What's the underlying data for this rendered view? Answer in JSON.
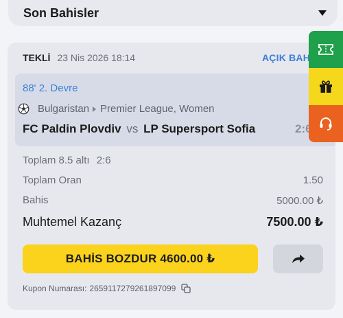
{
  "header": {
    "title": "Son Bahisler"
  },
  "bet": {
    "type": "TEKLİ",
    "date": "23 Nis 2026 18:14",
    "status": "AÇIK BAHİS",
    "event": {
      "minute": "88' 2. Devre",
      "country": "Bulgaristan",
      "league": "Premier League, Women",
      "home": "FC Paldin Plovdiv",
      "vs": "vs",
      "away": "LP Supersport Sofia",
      "score": "2:6"
    },
    "selection": "Toplam 8.5 altı",
    "selection_score": "2:6",
    "total_odds_label": "Toplam Oran",
    "total_odds": "1.50",
    "stake_label": "Bahis",
    "stake": "5000.00 ₺",
    "potential_label": "Muhtemel Kazanç",
    "potential": "7500.00 ₺",
    "cashout_label": "BAHİS BOZDUR 4600.00 ₺",
    "coupon_label": "Kupon Numarası:",
    "coupon_number": "2659117279261897099"
  },
  "side_buttons": [
    {
      "icon": "ticket-icon",
      "color": "#1fa04a"
    },
    {
      "icon": "gift-icon",
      "color": "#f5d71c"
    },
    {
      "icon": "headset-icon",
      "color": "#ea6120"
    }
  ],
  "colors": {
    "accent": "#fbd21c",
    "link": "#3b82d6"
  }
}
